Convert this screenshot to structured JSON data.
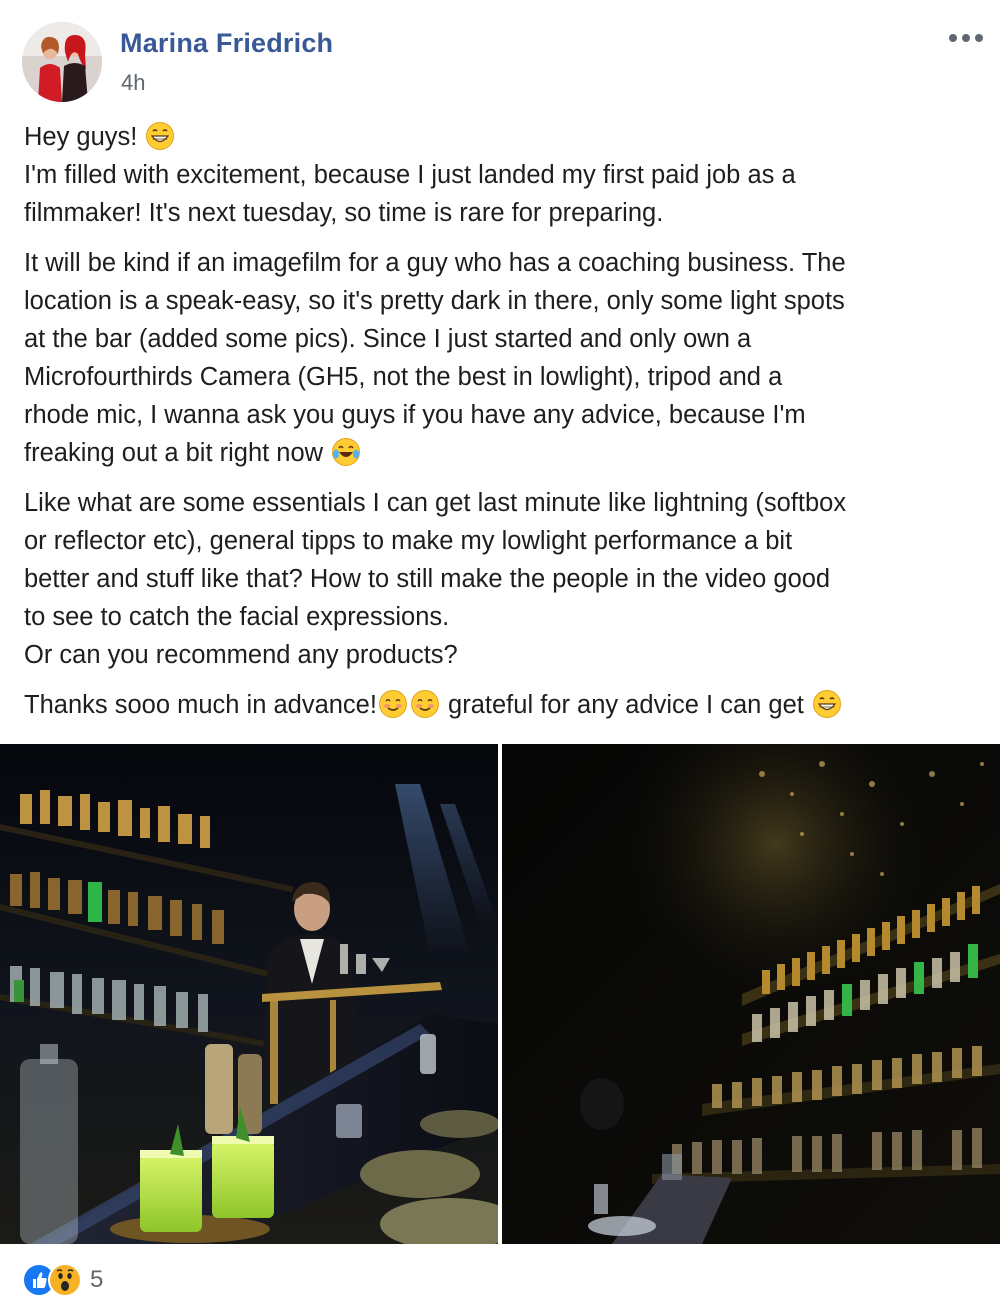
{
  "post": {
    "author": "Marina Friedrich",
    "timestamp": "4h",
    "menu_icon": "more-options-icon",
    "paragraphs": [
      {
        "lines": [
          {
            "text": "Hey guys! ",
            "emoji_after": [
              "grinning-face"
            ]
          },
          {
            "text": "I'm filled with excitement, because I just landed my first paid job as a"
          },
          {
            "text": "filmmaker! It's next tuesday, so time is rare for preparing."
          }
        ]
      },
      {
        "lines": [
          {
            "text": "It will be kind if an imagefilm for a guy who has a coaching business. The"
          },
          {
            "text": "location is a speak-easy, so it's pretty dark in there, only some light spots"
          },
          {
            "text": "at the bar (added some pics). Since I just started and only own a"
          },
          {
            "text": "Microfourthirds Camera (GH5, not the best in lowlight), tripod and a"
          },
          {
            "text": "rhode mic, I wanna ask you guys if you have any advice, because I'm"
          },
          {
            "text": "freaking out a bit right now ",
            "emoji_after": [
              "tears-of-joy"
            ]
          }
        ]
      },
      {
        "lines": [
          {
            "text": "Like what are some essentials I can get last minute like lightning (softbox"
          },
          {
            "text": "or reflector etc), general tipps to make my lowlight performance a bit"
          },
          {
            "text": "better and stuff like that? How to still make the people in the video good"
          },
          {
            "text": "to see to catch the facial expressions."
          },
          {
            "text": "Or can you recommend any products?"
          }
        ]
      },
      {
        "lines": [
          {
            "text": "Thanks sooo much in advance!",
            "emoji_after": [
              "smiling-face",
              "smiling-face"
            ],
            "text_after": " grateful for any advice I can get ",
            "emoji_end": [
              "grinning-face"
            ]
          }
        ]
      }
    ],
    "photos": [
      {
        "name": "bar-photo-bartender-cocktails"
      },
      {
        "name": "bar-photo-dark-shelves"
      }
    ],
    "reactions": {
      "icons": [
        "like-icon",
        "wow-icon"
      ],
      "count": "5"
    }
  },
  "colors": {
    "author_link": "#385898",
    "meta_gray": "#606770",
    "text": "#1c1e21",
    "like_blue": "#1877f2",
    "wow_yellow": "#f7b125"
  }
}
